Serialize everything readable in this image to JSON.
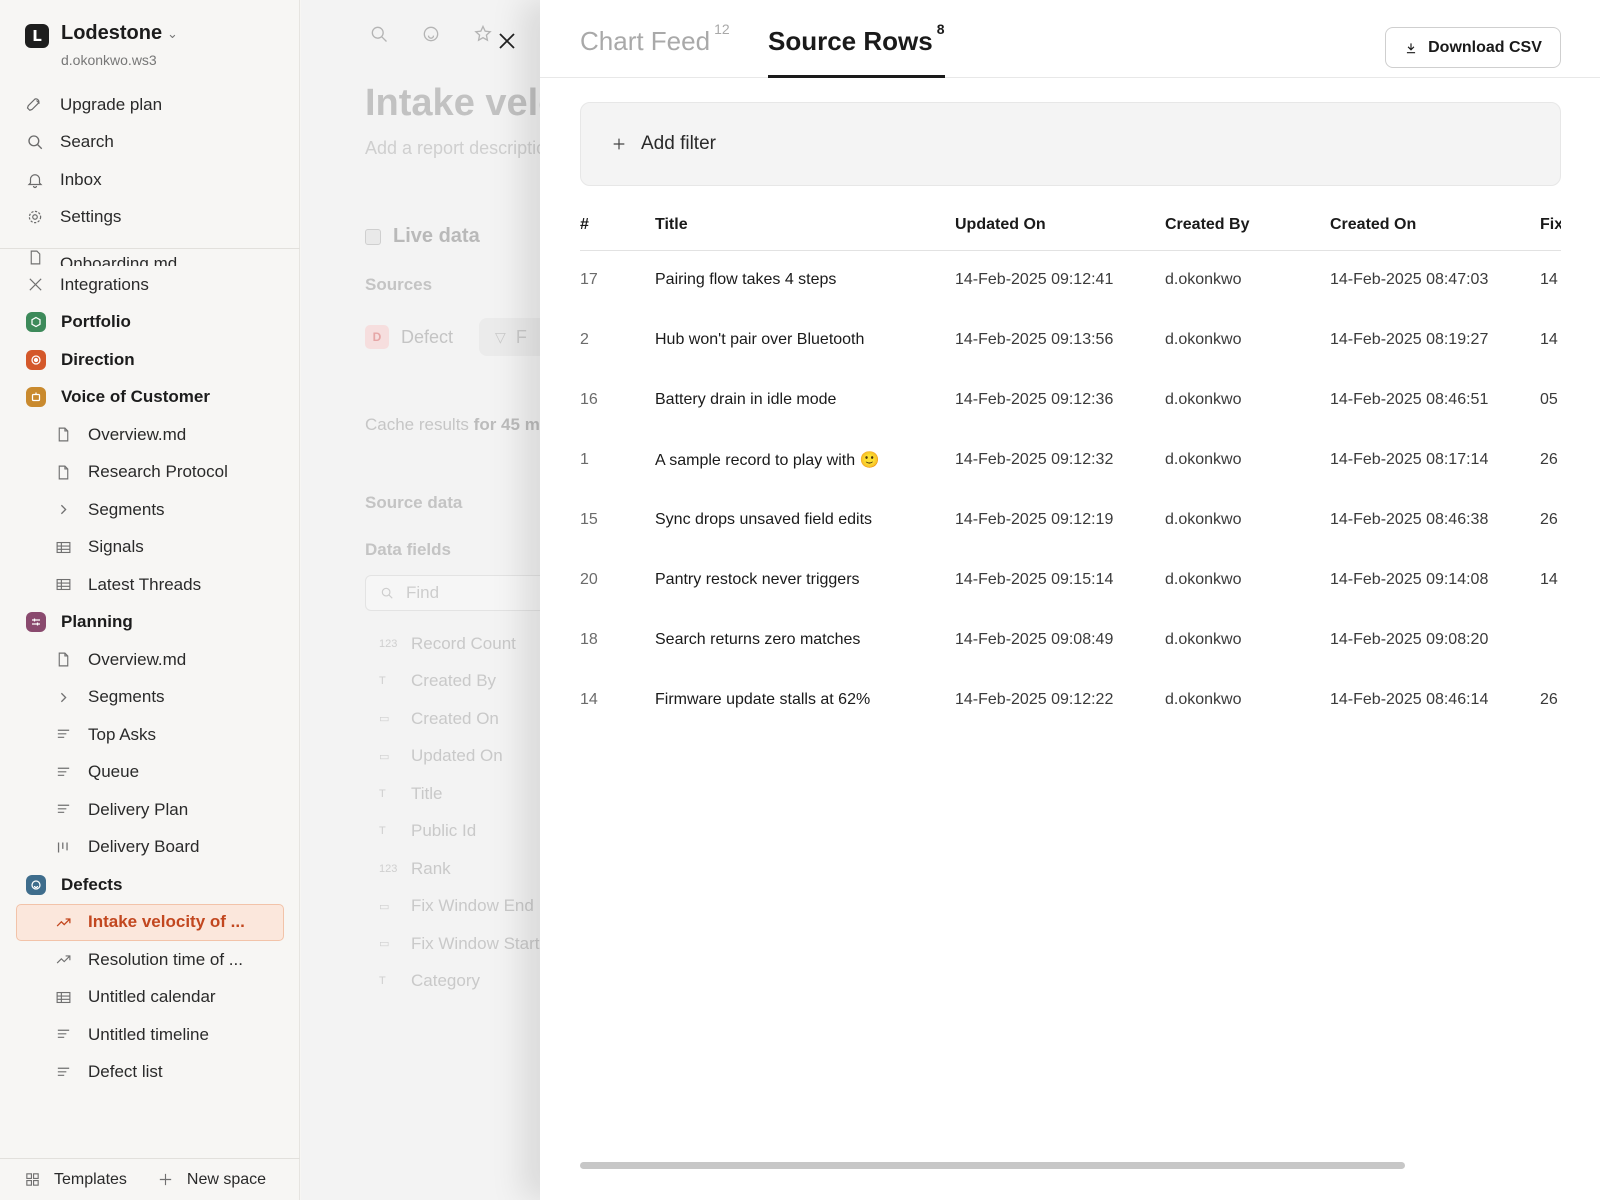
{
  "workspace": {
    "name": "Lodestone",
    "user": "d.okonkwo.ws3",
    "logo_letter": "L"
  },
  "nav": [
    {
      "label": "Upgrade plan",
      "icon": "rocket-icon"
    },
    {
      "label": "Search",
      "icon": "search-icon"
    },
    {
      "label": "Inbox",
      "icon": "bell-icon"
    },
    {
      "label": "Settings",
      "icon": "gear-icon"
    }
  ],
  "tree": {
    "partial_item": "Onboarding.md",
    "integrations": "Integrations",
    "portfolio": "Portfolio",
    "direction": "Direction",
    "voc": {
      "label": "Voice of Customer",
      "items": [
        "Overview.md",
        "Research Protocol",
        "Segments",
        "Signals",
        "Latest Threads"
      ]
    },
    "planning": {
      "label": "Planning",
      "items": [
        "Overview.md",
        "Segments",
        "Top Asks",
        "Queue",
        "Delivery Plan",
        "Delivery Board"
      ]
    },
    "defects": {
      "label": "Defects",
      "items": [
        "Intake velocity of ...",
        "Resolution time of ...",
        "Untitled calendar",
        "Untitled timeline",
        "Defect list"
      ]
    }
  },
  "footer": {
    "templates": "Templates",
    "new_space": "New space"
  },
  "colors": {
    "accent": "#c2471f",
    "portfolio": "#3d8a5a",
    "direction": "#d4582a",
    "voc": "#c98a2e",
    "planning": "#8a4a6e",
    "defects": "#3f6d8c"
  },
  "report": {
    "title": "Intake velocity of",
    "description_placeholder": "Add a report description",
    "live_data": "Live data",
    "sources_label": "Sources",
    "source_chip": "Defect",
    "source_initial": "D",
    "filter_chip": "F",
    "cache_prefix": "Cache results",
    "cache_bold": "for 45 m",
    "source_data_label": "Source data",
    "data_fields_label": "Data fields",
    "find_placeholder": "Find",
    "fields": [
      {
        "type": "123",
        "label": "Record Count"
      },
      {
        "type": "T",
        "label": "Created By"
      },
      {
        "type": "cal",
        "label": "Created On"
      },
      {
        "type": "cal",
        "label": "Updated On"
      },
      {
        "type": "T",
        "label": "Title"
      },
      {
        "type": "T",
        "label": "Public Id"
      },
      {
        "type": "123",
        "label": "Rank"
      },
      {
        "type": "cal",
        "label": "Fix Window End"
      },
      {
        "type": "cal",
        "label": "Fix Window Start"
      },
      {
        "type": "T",
        "label": "Category"
      }
    ]
  },
  "drawer": {
    "tabs": [
      {
        "label": "Chart Feed",
        "count": "12"
      },
      {
        "label": "Source Rows",
        "count": "8"
      }
    ],
    "download_label": "Download CSV",
    "add_filter": "Add filter",
    "columns": [
      "#",
      "Title",
      "Updated On",
      "Created By",
      "Created On",
      "Fix"
    ],
    "rows": [
      {
        "id": "17",
        "title": "Pairing flow takes 4 steps",
        "updated": "14-Feb-2025 09:12:41",
        "by": "d.okonkwo",
        "created": "14-Feb-2025 08:47:03",
        "fix": "14"
      },
      {
        "id": "2",
        "title": "Hub won't pair over Bluetooth",
        "updated": "14-Feb-2025 09:13:56",
        "by": "d.okonkwo",
        "created": "14-Feb-2025 08:19:27",
        "fix": "14"
      },
      {
        "id": "16",
        "title": "Battery drain in idle mode",
        "updated": "14-Feb-2025 09:12:36",
        "by": "d.okonkwo",
        "created": "14-Feb-2025 08:46:51",
        "fix": "05"
      },
      {
        "id": "1",
        "title": "A sample record to play with 🙂",
        "updated": "14-Feb-2025 09:12:32",
        "by": "d.okonkwo",
        "created": "14-Feb-2025 08:17:14",
        "fix": "26"
      },
      {
        "id": "15",
        "title": "Sync drops unsaved field edits",
        "updated": "14-Feb-2025 09:12:19",
        "by": "d.okonkwo",
        "created": "14-Feb-2025 08:46:38",
        "fix": "26"
      },
      {
        "id": "20",
        "title": "Pantry restock never triggers",
        "updated": "14-Feb-2025 09:15:14",
        "by": "d.okonkwo",
        "created": "14-Feb-2025 09:14:08",
        "fix": "14"
      },
      {
        "id": "18",
        "title": "Search returns zero matches",
        "updated": "14-Feb-2025 09:08:49",
        "by": "d.okonkwo",
        "created": "14-Feb-2025 09:08:20",
        "fix": ""
      },
      {
        "id": "14",
        "title": "Firmware update stalls at 62%",
        "updated": "14-Feb-2025 09:12:22",
        "by": "d.okonkwo",
        "created": "14-Feb-2025 08:46:14",
        "fix": "26"
      }
    ]
  }
}
